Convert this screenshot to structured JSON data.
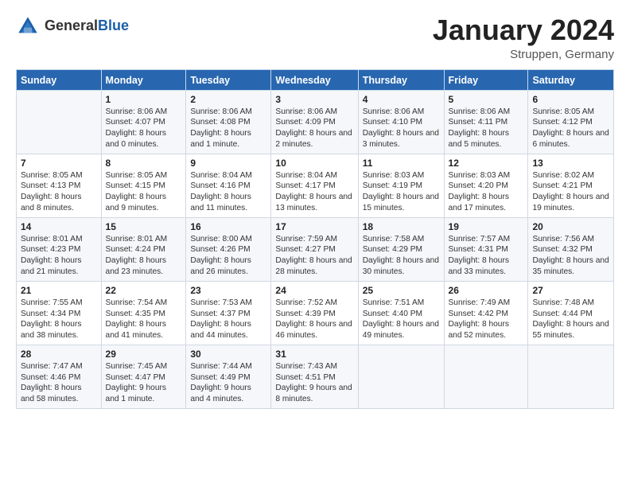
{
  "header": {
    "logo_general": "General",
    "logo_blue": "Blue",
    "month_title": "January 2024",
    "subtitle": "Struppen, Germany"
  },
  "days_of_week": [
    "Sunday",
    "Monday",
    "Tuesday",
    "Wednesday",
    "Thursday",
    "Friday",
    "Saturday"
  ],
  "weeks": [
    [
      {
        "day": "",
        "sunrise": "",
        "sunset": "",
        "daylight": ""
      },
      {
        "day": "1",
        "sunrise": "Sunrise: 8:06 AM",
        "sunset": "Sunset: 4:07 PM",
        "daylight": "Daylight: 8 hours and 0 minutes."
      },
      {
        "day": "2",
        "sunrise": "Sunrise: 8:06 AM",
        "sunset": "Sunset: 4:08 PM",
        "daylight": "Daylight: 8 hours and 1 minute."
      },
      {
        "day": "3",
        "sunrise": "Sunrise: 8:06 AM",
        "sunset": "Sunset: 4:09 PM",
        "daylight": "Daylight: 8 hours and 2 minutes."
      },
      {
        "day": "4",
        "sunrise": "Sunrise: 8:06 AM",
        "sunset": "Sunset: 4:10 PM",
        "daylight": "Daylight: 8 hours and 3 minutes."
      },
      {
        "day": "5",
        "sunrise": "Sunrise: 8:06 AM",
        "sunset": "Sunset: 4:11 PM",
        "daylight": "Daylight: 8 hours and 5 minutes."
      },
      {
        "day": "6",
        "sunrise": "Sunrise: 8:05 AM",
        "sunset": "Sunset: 4:12 PM",
        "daylight": "Daylight: 8 hours and 6 minutes."
      }
    ],
    [
      {
        "day": "7",
        "sunrise": "Sunrise: 8:05 AM",
        "sunset": "Sunset: 4:13 PM",
        "daylight": "Daylight: 8 hours and 8 minutes."
      },
      {
        "day": "8",
        "sunrise": "Sunrise: 8:05 AM",
        "sunset": "Sunset: 4:15 PM",
        "daylight": "Daylight: 8 hours and 9 minutes."
      },
      {
        "day": "9",
        "sunrise": "Sunrise: 8:04 AM",
        "sunset": "Sunset: 4:16 PM",
        "daylight": "Daylight: 8 hours and 11 minutes."
      },
      {
        "day": "10",
        "sunrise": "Sunrise: 8:04 AM",
        "sunset": "Sunset: 4:17 PM",
        "daylight": "Daylight: 8 hours and 13 minutes."
      },
      {
        "day": "11",
        "sunrise": "Sunrise: 8:03 AM",
        "sunset": "Sunset: 4:19 PM",
        "daylight": "Daylight: 8 hours and 15 minutes."
      },
      {
        "day": "12",
        "sunrise": "Sunrise: 8:03 AM",
        "sunset": "Sunset: 4:20 PM",
        "daylight": "Daylight: 8 hours and 17 minutes."
      },
      {
        "day": "13",
        "sunrise": "Sunrise: 8:02 AM",
        "sunset": "Sunset: 4:21 PM",
        "daylight": "Daylight: 8 hours and 19 minutes."
      }
    ],
    [
      {
        "day": "14",
        "sunrise": "Sunrise: 8:01 AM",
        "sunset": "Sunset: 4:23 PM",
        "daylight": "Daylight: 8 hours and 21 minutes."
      },
      {
        "day": "15",
        "sunrise": "Sunrise: 8:01 AM",
        "sunset": "Sunset: 4:24 PM",
        "daylight": "Daylight: 8 hours and 23 minutes."
      },
      {
        "day": "16",
        "sunrise": "Sunrise: 8:00 AM",
        "sunset": "Sunset: 4:26 PM",
        "daylight": "Daylight: 8 hours and 26 minutes."
      },
      {
        "day": "17",
        "sunrise": "Sunrise: 7:59 AM",
        "sunset": "Sunset: 4:27 PM",
        "daylight": "Daylight: 8 hours and 28 minutes."
      },
      {
        "day": "18",
        "sunrise": "Sunrise: 7:58 AM",
        "sunset": "Sunset: 4:29 PM",
        "daylight": "Daylight: 8 hours and 30 minutes."
      },
      {
        "day": "19",
        "sunrise": "Sunrise: 7:57 AM",
        "sunset": "Sunset: 4:31 PM",
        "daylight": "Daylight: 8 hours and 33 minutes."
      },
      {
        "day": "20",
        "sunrise": "Sunrise: 7:56 AM",
        "sunset": "Sunset: 4:32 PM",
        "daylight": "Daylight: 8 hours and 35 minutes."
      }
    ],
    [
      {
        "day": "21",
        "sunrise": "Sunrise: 7:55 AM",
        "sunset": "Sunset: 4:34 PM",
        "daylight": "Daylight: 8 hours and 38 minutes."
      },
      {
        "day": "22",
        "sunrise": "Sunrise: 7:54 AM",
        "sunset": "Sunset: 4:35 PM",
        "daylight": "Daylight: 8 hours and 41 minutes."
      },
      {
        "day": "23",
        "sunrise": "Sunrise: 7:53 AM",
        "sunset": "Sunset: 4:37 PM",
        "daylight": "Daylight: 8 hours and 44 minutes."
      },
      {
        "day": "24",
        "sunrise": "Sunrise: 7:52 AM",
        "sunset": "Sunset: 4:39 PM",
        "daylight": "Daylight: 8 hours and 46 minutes."
      },
      {
        "day": "25",
        "sunrise": "Sunrise: 7:51 AM",
        "sunset": "Sunset: 4:40 PM",
        "daylight": "Daylight: 8 hours and 49 minutes."
      },
      {
        "day": "26",
        "sunrise": "Sunrise: 7:49 AM",
        "sunset": "Sunset: 4:42 PM",
        "daylight": "Daylight: 8 hours and 52 minutes."
      },
      {
        "day": "27",
        "sunrise": "Sunrise: 7:48 AM",
        "sunset": "Sunset: 4:44 PM",
        "daylight": "Daylight: 8 hours and 55 minutes."
      }
    ],
    [
      {
        "day": "28",
        "sunrise": "Sunrise: 7:47 AM",
        "sunset": "Sunset: 4:46 PM",
        "daylight": "Daylight: 8 hours and 58 minutes."
      },
      {
        "day": "29",
        "sunrise": "Sunrise: 7:45 AM",
        "sunset": "Sunset: 4:47 PM",
        "daylight": "Daylight: 9 hours and 1 minute."
      },
      {
        "day": "30",
        "sunrise": "Sunrise: 7:44 AM",
        "sunset": "Sunset: 4:49 PM",
        "daylight": "Daylight: 9 hours and 4 minutes."
      },
      {
        "day": "31",
        "sunrise": "Sunrise: 7:43 AM",
        "sunset": "Sunset: 4:51 PM",
        "daylight": "Daylight: 9 hours and 8 minutes."
      },
      {
        "day": "",
        "sunrise": "",
        "sunset": "",
        "daylight": ""
      },
      {
        "day": "",
        "sunrise": "",
        "sunset": "",
        "daylight": ""
      },
      {
        "day": "",
        "sunrise": "",
        "sunset": "",
        "daylight": ""
      }
    ]
  ]
}
